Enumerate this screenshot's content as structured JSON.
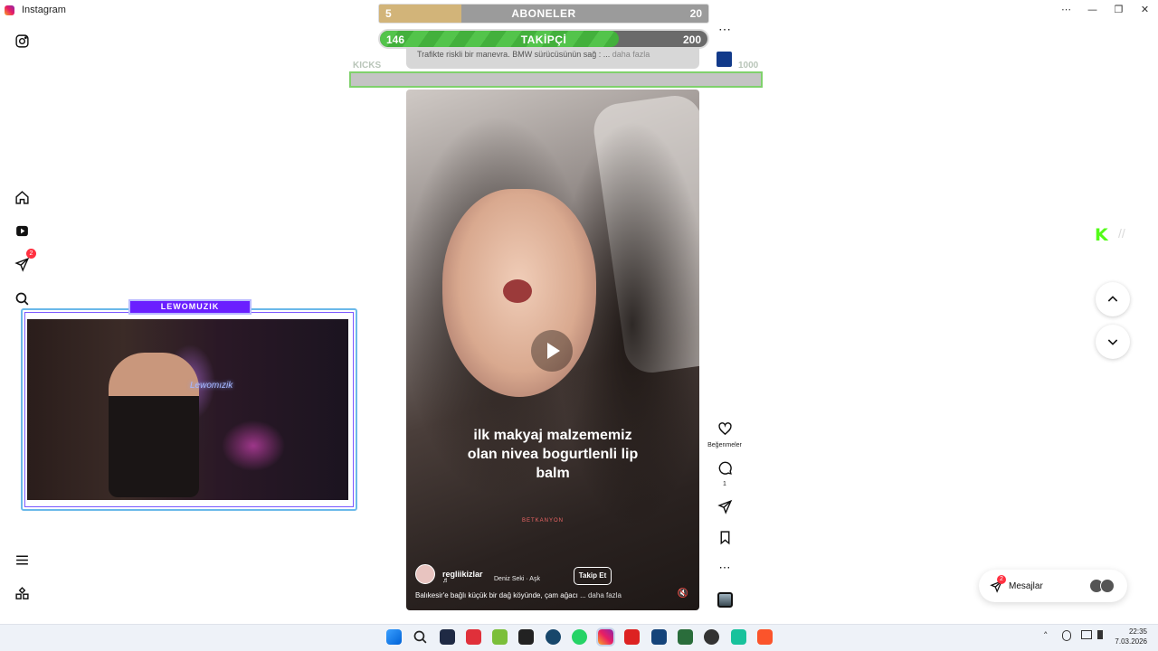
{
  "window": {
    "title": "Instagram",
    "controls": [
      "⋯",
      "—",
      "❐",
      "✕"
    ]
  },
  "overlay": {
    "subs": {
      "label": "ABONELER",
      "current": "5",
      "goal": "20",
      "progress": 0.25
    },
    "follows": {
      "label": "TAKİPÇİ",
      "current": "146",
      "goal": "200",
      "progress": 0.73
    },
    "kicks": {
      "label": "KICKS",
      "goal": "1000"
    },
    "prev_caption": "Trafikte riskli bir manevra. BMW sürücüsünün sağ : ...",
    "prev_more": "daha fazla"
  },
  "reel": {
    "overlay_text": "ilk makyaj malzememiz olan nivea bogurtlenli lip balm",
    "watermark": "BETKANYON",
    "username": "regliikizlar",
    "music_icon": "♬",
    "audio": "Deniz Seki · Aşk",
    "follow_label": "Takip Et",
    "caption": "Balıkesir'e bağlı küçük bir dağ köyünde, çam ağacı ...",
    "caption_more": "daha fazla",
    "mute_icon": "🔇"
  },
  "actions": {
    "likes_label": "Beğenmeler",
    "comments_count": "1",
    "more": "⋯"
  },
  "sidebar": {
    "notifications_badge": "2"
  },
  "messages": {
    "label": "Mesajlar",
    "badge": "2"
  },
  "webcam": {
    "title": "LEWOMUZIK",
    "neon": "Lewomızik"
  },
  "kick_logo": {
    "letter": "K",
    "slash": "//"
  },
  "taskbar": {
    "time": "22:35",
    "date": "7.03.2026",
    "tray_chevron": "˄"
  }
}
